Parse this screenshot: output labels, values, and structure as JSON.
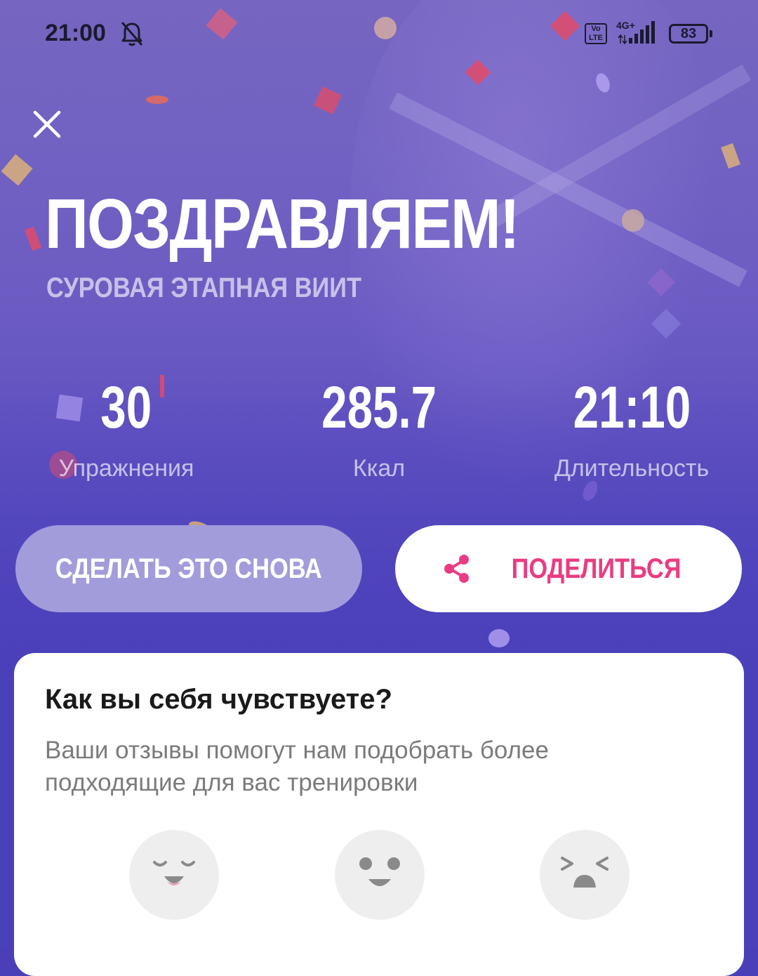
{
  "status_bar": {
    "time": "21:00",
    "volte": "Vo LTE",
    "network": "4G+",
    "battery": "83",
    "icons": [
      "bell-muted-icon",
      "signal-icon",
      "battery-icon"
    ]
  },
  "header": {
    "close_icon": "close-icon",
    "title": "ПОЗДРАВЛЯЕМ!",
    "subtitle": "СУРОВАЯ ЭТАПНАЯ ВИИТ"
  },
  "stats": [
    {
      "value": "30",
      "label": "Упражнения"
    },
    {
      "value": "285.7",
      "label": "Ккал"
    },
    {
      "value": "21:10",
      "label": "Длительность"
    }
  ],
  "actions": {
    "again_label": "СДЕЛАТЬ ЭТО СНОВА",
    "share_label": "ПОДЕЛИТЬСЯ",
    "share_icon": "share-icon"
  },
  "feedback": {
    "title": "Как вы себя чувствуете?",
    "description": "Ваши отзывы помогут нам подобрать более подходящие для вас тренировки",
    "faces": [
      {
        "icon": "happy-face-icon"
      },
      {
        "icon": "surprised-face-icon"
      },
      {
        "icon": "exhausted-face-icon"
      }
    ]
  },
  "colors": {
    "background": "#4a40ba",
    "accent_pink": "#ea3c82",
    "secondary_button": "#a29cdb",
    "card": "#ffffff"
  }
}
